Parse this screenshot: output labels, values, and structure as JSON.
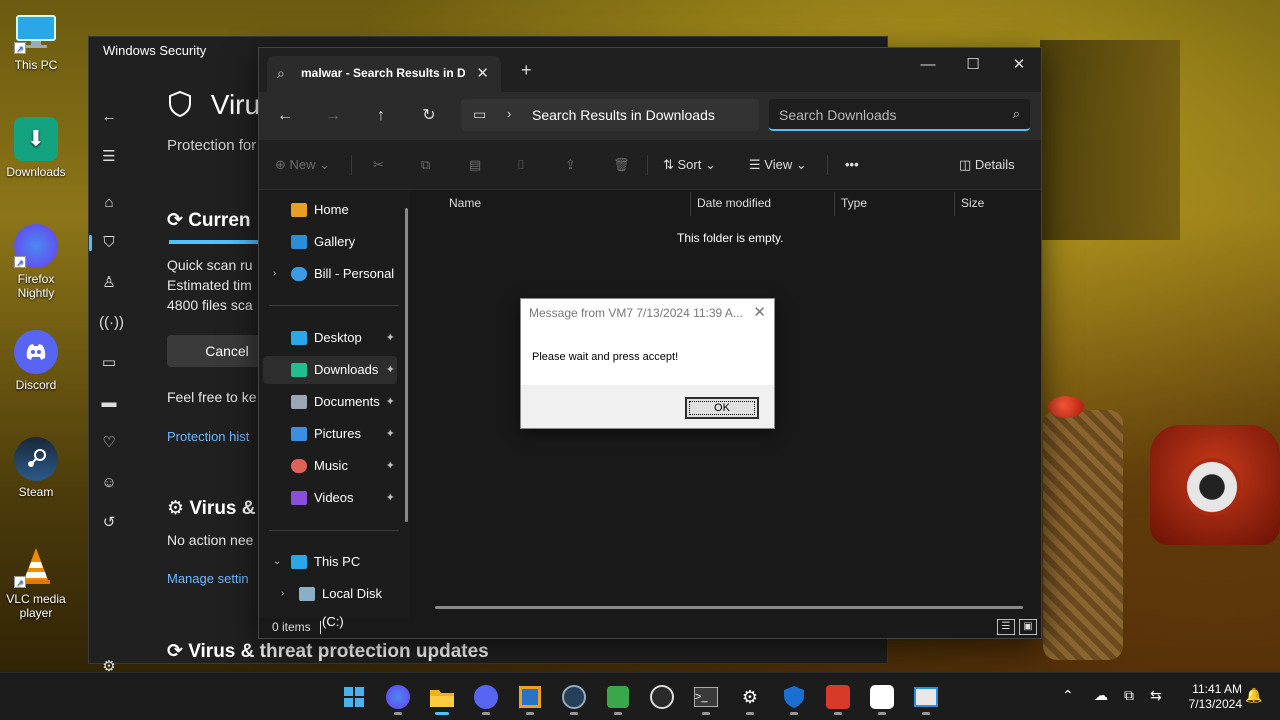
{
  "desktop": {
    "icons": [
      {
        "label": "This PC",
        "icon": "monitor-icon",
        "color": "#2aa7e8"
      },
      {
        "label": "Downloads",
        "icon": "download-folder-icon",
        "color": "#14a37f"
      },
      {
        "label": "Firefox Nightly",
        "icon": "firefox-nightly-icon",
        "color": "#6a3cf0"
      },
      {
        "label": "Discord",
        "icon": "discord-icon",
        "color": "#5865f2"
      },
      {
        "label": "Steam",
        "icon": "steam-icon",
        "color": "#1b2838"
      },
      {
        "label": "VLC media player",
        "icon": "vlc-cone-icon",
        "color": "#f08a00"
      }
    ]
  },
  "security": {
    "window_title": "Windows Security",
    "heading": "Virus",
    "subtitle": "Protection for",
    "current_heading": "Curren",
    "scan_lines": [
      "Quick scan ru",
      "Estimated tim",
      "4800 files sca"
    ],
    "cancel_label": "Cancel",
    "feel_free": "Feel free to ke",
    "protection_history": "Protection hist",
    "virus_heading": "Virus &",
    "no_action": "No action nee",
    "manage_settings": "Manage settin",
    "updates_heading": "Virus & threat protection updates",
    "scan_progress_percent": 30,
    "accent_color": "#4cc2ff"
  },
  "explorer": {
    "tab_label": "malwar - Search Results in Downloads",
    "address": "Search Results in Downloads",
    "search_placeholder": "Search Downloads",
    "commands": {
      "new": "New",
      "sort": "Sort",
      "view": "View",
      "details": "Details"
    },
    "sidebar": [
      {
        "label": "Home",
        "icon": "home-icon",
        "color": "#e8a020"
      },
      {
        "label": "Gallery",
        "icon": "gallery-icon",
        "color": "#2b8fd8"
      },
      {
        "label": "Bill - Personal",
        "icon": "onedrive-cloud-icon",
        "color": "#3a9be6"
      },
      {
        "label": "Desktop",
        "icon": "desktop-icon",
        "color": "#2aa7e8"
      },
      {
        "label": "Downloads",
        "icon": "downloads-icon",
        "color": "#1fbf8f"
      },
      {
        "label": "Documents",
        "icon": "documents-icon",
        "color": "#9aa7b8"
      },
      {
        "label": "Pictures",
        "icon": "pictures-icon",
        "color": "#3a8fe0"
      },
      {
        "label": "Music",
        "icon": "music-icon",
        "color": "#e0605a"
      },
      {
        "label": "Videos",
        "icon": "videos-icon",
        "color": "#8a4fd8"
      },
      {
        "label": "This PC",
        "icon": "this-pc-icon",
        "color": "#2aa7e8"
      },
      {
        "label": "Local Disk (C:)",
        "icon": "local-disk-icon",
        "color": "#8ab0c8"
      }
    ],
    "columns": [
      "Name",
      "Date modified",
      "Type",
      "Size"
    ],
    "empty_message": "This folder is empty.",
    "status_items": "0 items"
  },
  "message_box": {
    "title": "Message from VM7 7/13/2024 11:39 A...",
    "body": "Please wait and press accept!",
    "ok_label": "OK"
  },
  "taskbar": {
    "apps": [
      {
        "icon": "windows-start-icon",
        "color": "#2a8ee0"
      },
      {
        "icon": "firefox-nightly-icon",
        "color": "#6a3cf0"
      },
      {
        "icon": "file-explorer-icon",
        "color": "#f0b020"
      },
      {
        "icon": "discord-icon",
        "color": "#5865f2"
      },
      {
        "icon": "virtualbox-icon",
        "color": "#2a72c8"
      },
      {
        "icon": "steam-icon",
        "color": "#24405a"
      },
      {
        "icon": "camtasia-icon",
        "color": "#3aa84a"
      },
      {
        "icon": "obs-icon",
        "color": "#2a2a2a"
      },
      {
        "icon": "terminal-icon",
        "color": "#3a3a3a"
      },
      {
        "icon": "settings-gear-icon",
        "color": "#5a6a7a"
      },
      {
        "icon": "windows-security-icon",
        "color": "#1a6fd0"
      },
      {
        "icon": "psiphon-icon",
        "color": "#d83a2a"
      },
      {
        "icon": "teamviewer-icon",
        "color": "#ffffff"
      },
      {
        "icon": "remote-desktop-icon",
        "color": "#2a8ee0"
      }
    ],
    "time": "11:41 AM",
    "date": "7/13/2024"
  }
}
